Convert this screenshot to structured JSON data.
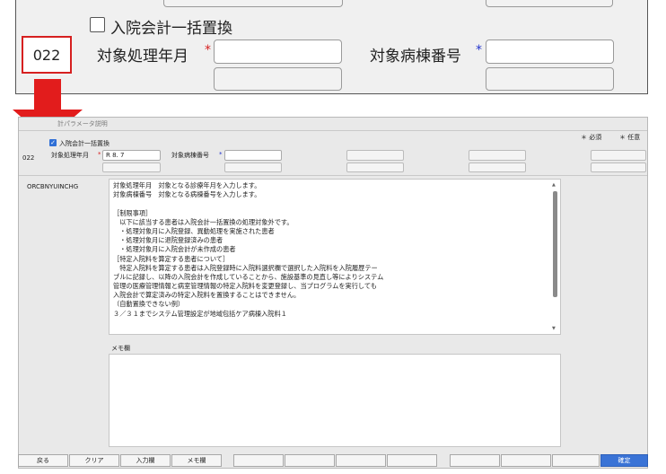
{
  "zoom": {
    "check_label": "入院会計一括置換",
    "code": "022",
    "field1_label": "対象処理年月",
    "field2_label": "対象病棟番号",
    "req_mark": "*",
    "opt_mark": "*"
  },
  "window": {
    "title": "計パラメータ説明",
    "legend_required": "＊ 必須",
    "legend_optional": "＊ 任意",
    "check_label": "入院会計一括置換",
    "code": "022",
    "field1_label": "対象処理年月",
    "field1_value": "R 8. 7",
    "field2_label": "対象病棟番号",
    "program_name": "ORCBNYUINCHG",
    "description_lines": [
      "対象処理年月　対象となる診療年月を入力します。",
      "対象病棟番号　対象となる病棟番号を入力します。",
      "",
      "［制限事項］",
      "　以下に該当する患者は入院会計一括置換の処理対象外です。",
      "　・処理対象月に入院登録、異動処理を実施された患者",
      "　・処理対象月に退院登録済みの患者",
      "　・処理対象月に入院会計が未作成の患者",
      "［特定入院料を算定する患者について］",
      "　特定入院料を算定する患者は入院登録時に入院料選択欄で選択した入院料を入院履歴テー",
      "ブルに記録し、以降の入院会計を作成していることから、施設基準の見直し等によりシステム",
      "管理の医療管理情報と病室管理情報の特定入院料を変更登録し、当プログラムを実行しても",
      "入院会計で算定済みの特定入院料を置換することはできません。",
      "（自動置換できない例）",
      "３／３１までシステム管理設定が地域包括ケア病棟入院料１"
    ],
    "memo_label": "メモ欄"
  },
  "footer": {
    "back": "戻る",
    "clear": "クリア",
    "input_help": "入力欄",
    "memo": "メモ欄",
    "confirm": "確定"
  }
}
